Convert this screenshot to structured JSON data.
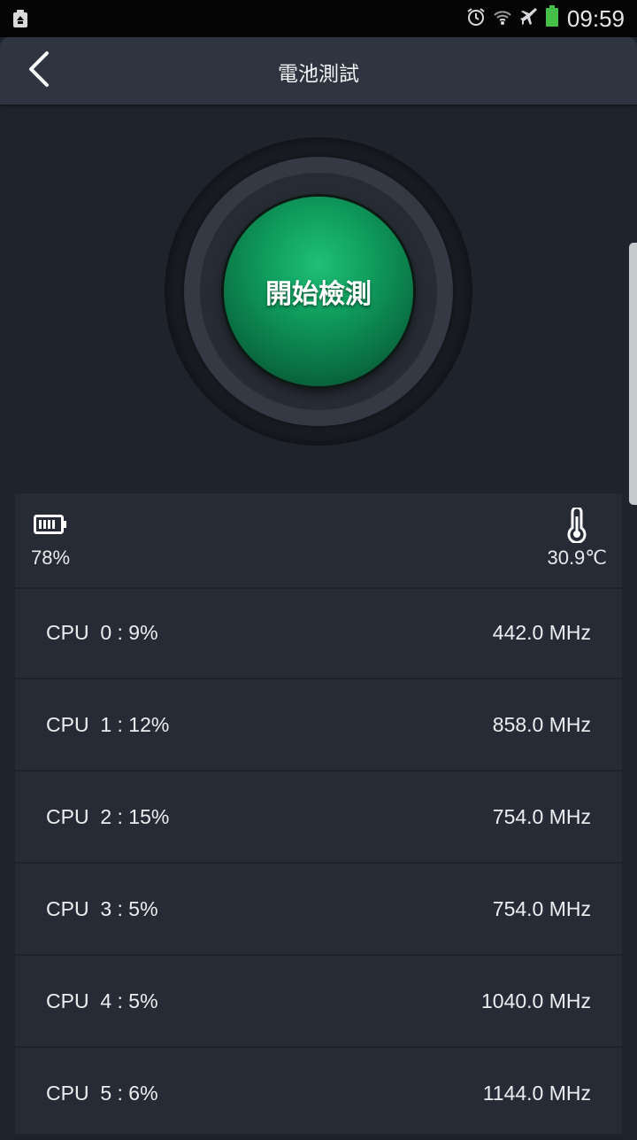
{
  "status_bar": {
    "time": "09:59",
    "icons": [
      "recycle-icon",
      "alarm-icon",
      "wifi-icon",
      "airplane-icon",
      "battery-status-icon"
    ]
  },
  "header": {
    "title": "電池測試",
    "back_icon": "chevron-left-icon"
  },
  "main_button": {
    "label": "開始檢測",
    "color": "#0f9c5d"
  },
  "info": {
    "battery_icon": "battery-icon",
    "battery_level": "78%",
    "thermometer_icon": "thermometer-icon",
    "temperature": "30.9℃"
  },
  "cpu_list": [
    {
      "label": "CPU  0 : 9%",
      "freq": "442.0 MHz"
    },
    {
      "label": "CPU  1 : 12%",
      "freq": "858.0 MHz"
    },
    {
      "label": "CPU  2 : 15%",
      "freq": "754.0 MHz"
    },
    {
      "label": "CPU  3 : 5%",
      "freq": "754.0 MHz"
    },
    {
      "label": "CPU  4 : 5%",
      "freq": "1040.0 MHz"
    },
    {
      "label": "CPU  5 : 6%",
      "freq": "1144.0 MHz"
    }
  ]
}
